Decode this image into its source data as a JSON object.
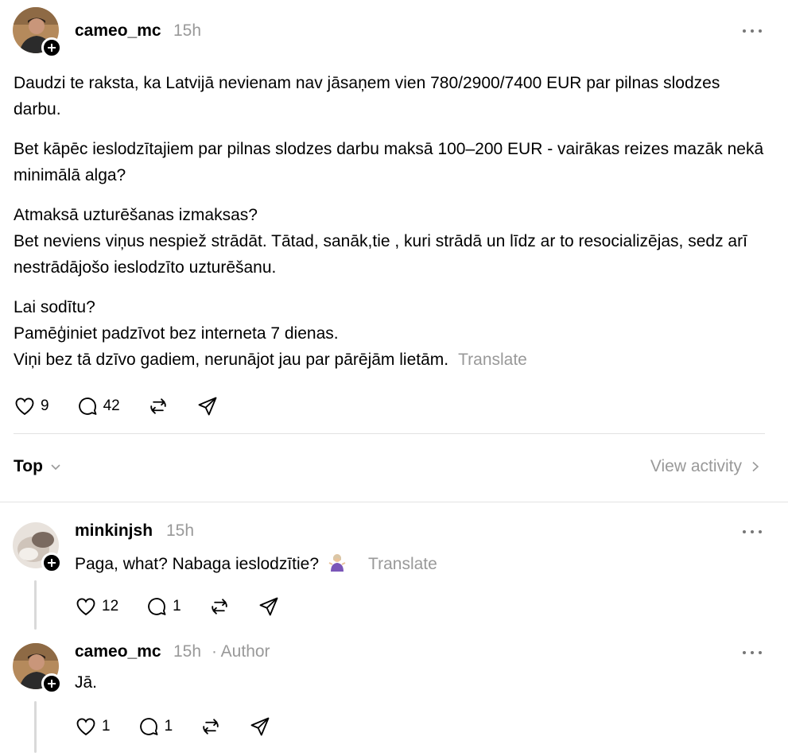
{
  "post": {
    "username": "cameo_mc",
    "time": "15h",
    "paragraphs": [
      "Daudzi te raksta, ka Latvijā nevienam nav jāsaņem vien 780/2900/7400 EUR par pilnas slodzes darbu.",
      "Bet kāpēc ieslodzītajiem par pilnas slodzes darbu maksā 100–200 EUR - vairākas reizes mazāk nekā minimālā alga?",
      "Atmaksā uzturēšanas izmaksas?",
      "Bet neviens viņus nespiež strādāt. Tātad, sanāk,tie , kuri strādā un līdz ar to resocializējas, sedz arī nestrādājošo ieslodzīto uzturēšanu.",
      "Lai sodītu?",
      "Pamēģiniet padzīvot bez interneta 7 dienas.",
      "Viņi bez tā dzīvo gadiem, nerunājot jau par pārējām lietām."
    ],
    "translate_label": "Translate",
    "likes": "9",
    "replies": "42"
  },
  "sort": {
    "label": "Top",
    "view_activity": "View activity"
  },
  "replies": [
    {
      "username": "minkinjsh",
      "time": "15h",
      "text": "Paga, what? Nabaga ieslodzītie?",
      "emoji": "🤷‍♀️",
      "translate_label": "Translate",
      "likes": "12",
      "replies": "1"
    },
    {
      "username": "cameo_mc",
      "time": "15h",
      "author_label": "· Author",
      "text": "Jā.",
      "likes": "1",
      "replies": "1"
    }
  ]
}
